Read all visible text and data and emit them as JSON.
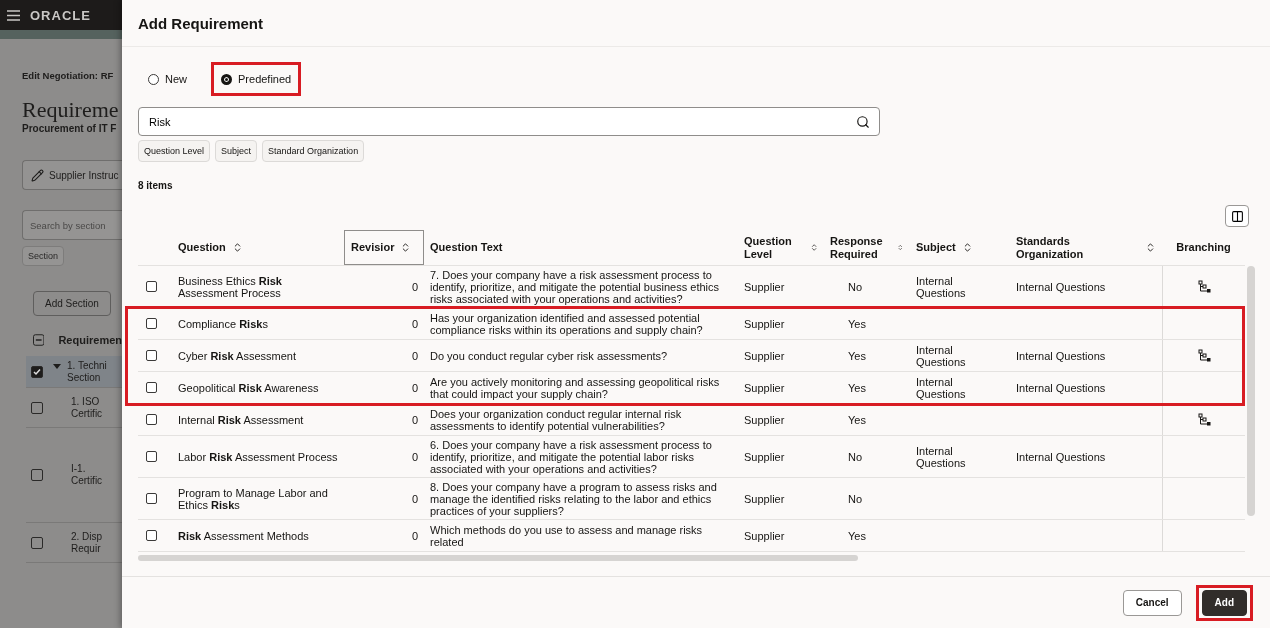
{
  "background_page": {
    "brand": "ORACLE",
    "breadcrumb": "Edit Negotiation: RF",
    "title": "Requireme",
    "subtitle": "Procurement of IT F",
    "instructions_button": "Supplier Instruc",
    "search": {
      "placeholder": "Search by section"
    },
    "filter_chip": "Section",
    "add_section_button": "Add Section",
    "table": {
      "header": "Requiremen",
      "rows": [
        {
          "kind": "section",
          "lines": [
            "1. Techni",
            "Section"
          ],
          "checked": true,
          "selected": true
        },
        {
          "kind": "item",
          "lines": [
            "1. ISO",
            "Certific"
          ],
          "checked": false,
          "selected": false
        },
        {
          "kind": "item",
          "lines": [
            "I-1.",
            "Certific"
          ],
          "checked": false,
          "selected": false
        },
        {
          "kind": "item",
          "lines": [
            "2. Disp",
            "Requir"
          ],
          "checked": false,
          "selected": false
        }
      ]
    }
  },
  "dialog": {
    "title": "Add Requirement",
    "radios": [
      {
        "label": "New",
        "selected": false,
        "highlighted": false
      },
      {
        "label": "Predefined",
        "selected": true,
        "highlighted": true
      }
    ],
    "search": {
      "value": "Risk"
    },
    "filter_chips": [
      "Question Level",
      "Subject",
      "Standard Organization"
    ],
    "item_count": "8 items",
    "table": {
      "columns": [
        {
          "label": "Question",
          "sortable": true,
          "focused": false
        },
        {
          "label": "Revisior",
          "sortable": true,
          "focused": true
        },
        {
          "label": "Question Text",
          "sortable": false,
          "focused": false
        },
        {
          "label": "Question Level",
          "sortable": true,
          "focused": false
        },
        {
          "label": "Response Required",
          "sortable": true,
          "focused": false
        },
        {
          "label": "Subject",
          "sortable": true,
          "focused": false
        },
        {
          "label": "Standards Organization",
          "sortable": true,
          "focused": false
        },
        {
          "label": "Branching",
          "sortable": false,
          "focused": false
        }
      ],
      "rows": [
        {
          "question": "Business Ethics **Risk** Assessment Process",
          "revision": "0",
          "text": "7. Does your company have a risk assessment process to identify, prioritize, and mitigate the potential business ethics risks associated with your operations and activities?",
          "level": "Supplier",
          "response": "No",
          "subject": "Internal Questions",
          "organization": "Internal Questions",
          "branching": true,
          "checked": false,
          "highlighted": false
        },
        {
          "question": "Compliance **Risk**s",
          "revision": "0",
          "text": "Has your organization identified and assessed potential compliance risks within its operations and supply chain?",
          "level": "Supplier",
          "response": "Yes",
          "checked": false,
          "branching": false,
          "highlighted": true
        },
        {
          "question": "Cyber **Risk** Assessment",
          "revision": "0",
          "text": "Do you conduct regular cyber risk assessments?",
          "level": "Supplier",
          "response": "Yes",
          "subject": "Internal Questions",
          "organization": "Internal Questions",
          "branching": true,
          "checked": false,
          "highlighted": true
        },
        {
          "question": "Geopolitical **Risk** Awareness",
          "revision": "0",
          "text": "Are you actively monitoring and assessing geopolitical risks that could impact your supply chain?",
          "level": "Supplier",
          "response": "Yes",
          "subject": "Internal Questions",
          "organization": "Internal Questions",
          "branching": false,
          "checked": false,
          "highlighted": true
        },
        {
          "question": "Internal **Risk** Assessment",
          "revision": "0",
          "text": "Does your organization conduct regular internal risk assessments to identify potential vulnerabilities?",
          "level": "Supplier",
          "response": "Yes",
          "branching": true,
          "checked": false,
          "highlighted": false
        },
        {
          "question": "Labor **Risk** Assessment Process",
          "revision": "0",
          "text": "6. Does your company have a risk assessment process to identify, prioritize, and mitigate the potential labor risks associated with your operations and activities?",
          "level": "Supplier",
          "response": "No",
          "subject": "Internal Questions",
          "organization": "Internal Questions",
          "branching": false,
          "checked": false,
          "highlighted": false
        },
        {
          "question": "Program to Manage Labor and Ethics **Risk**s",
          "revision": "0",
          "text": "8. Does your company have a program to assess risks and manage the identified risks relating to the labor and ethics practices of your suppliers?",
          "level": "Supplier",
          "response": "No",
          "branching": false,
          "checked": false,
          "highlighted": false
        },
        {
          "question": "**Risk** Assessment Methods",
          "revision": "0",
          "text": "Which methods do you use to assess and manage risks related",
          "level": "Supplier",
          "response": "Yes",
          "branching": false,
          "checked": false,
          "highlighted": false
        }
      ]
    },
    "buttons": [
      {
        "label": "Cancel",
        "kind": "secondary",
        "highlighted": false
      },
      {
        "label": "Add",
        "kind": "primary",
        "highlighted": true
      }
    ]
  }
}
